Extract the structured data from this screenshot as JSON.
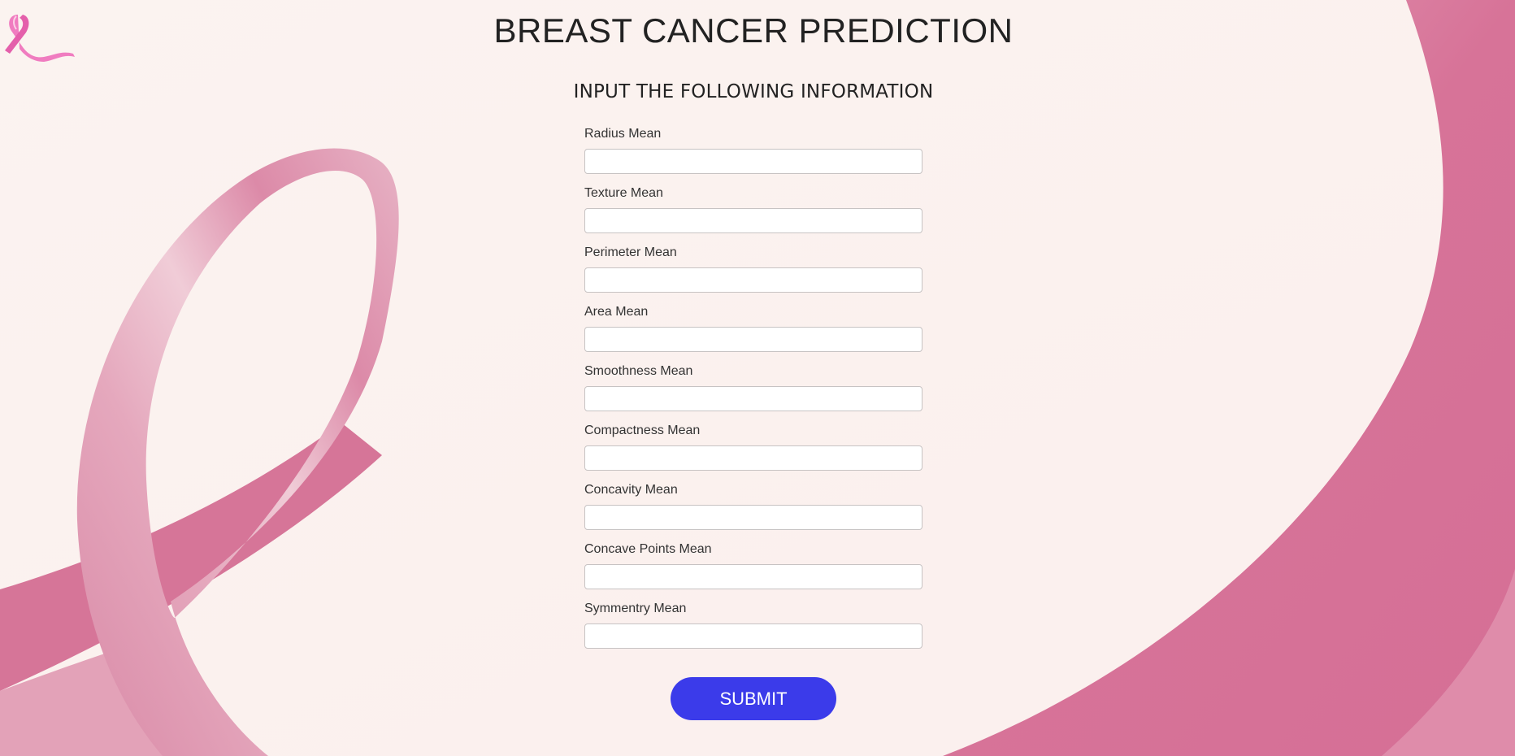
{
  "page": {
    "title": "BREAST CANCER PREDICTION",
    "subtitle": "INPUT THE FOLLOWING INFORMATION"
  },
  "logo": {
    "icon": "pink-ribbon-icon",
    "color": "#f07cc0"
  },
  "background": {
    "base_color": "#fbf1ef",
    "ribbon_color": "#d97199",
    "ribbon_light": "#e9a7bd"
  },
  "form": {
    "fields": [
      {
        "label": "Radius Mean",
        "value": "",
        "placeholder": ""
      },
      {
        "label": "Texture Mean",
        "value": "",
        "placeholder": ""
      },
      {
        "label": "Perimeter Mean",
        "value": "",
        "placeholder": ""
      },
      {
        "label": "Area Mean",
        "value": "",
        "placeholder": ""
      },
      {
        "label": "Smoothness Mean",
        "value": "",
        "placeholder": ""
      },
      {
        "label": "Compactness Mean",
        "value": "",
        "placeholder": ""
      },
      {
        "label": "Concavity Mean",
        "value": "",
        "placeholder": ""
      },
      {
        "label": "Concave Points Mean",
        "value": "",
        "placeholder": ""
      },
      {
        "label": "Symmentry Mean",
        "value": "",
        "placeholder": ""
      }
    ],
    "submit_label": "SUBMIT",
    "submit_color": "#3b3bea"
  }
}
